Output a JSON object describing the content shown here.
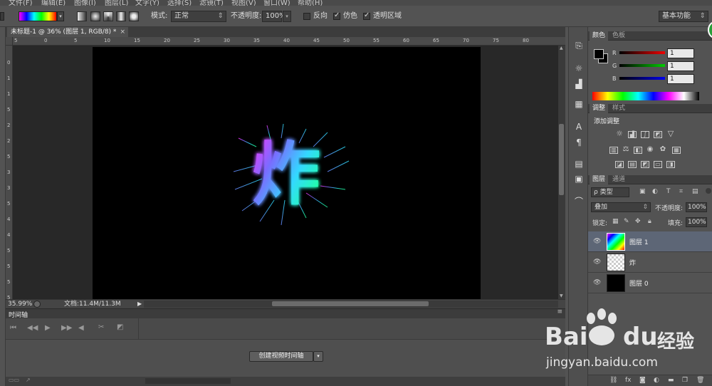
{
  "menubar": {
    "items": [
      "文件(F)",
      "编辑(E)",
      "图像(I)",
      "图层(L)",
      "文字(Y)",
      "选择(S)",
      "滤镜(T)",
      "视图(V)",
      "窗口(W)",
      "帮助(H)"
    ]
  },
  "options": {
    "mode_label": "模式:",
    "mode_value": "正常",
    "opacity_label": "不透明度:",
    "opacity_value": "100%",
    "reverse_label": "反向",
    "dither_label": "仿色",
    "transparency_label": "透明区域",
    "workspace": "基本功能",
    "reverse_checked": false,
    "dither_checked": true,
    "transparency_checked": true
  },
  "document": {
    "tab_title": "未标题-1 @ 36% (图层 1, RGB/8) *",
    "tab_close": "×",
    "canvas_text": "炸",
    "h_ruler_ticks": [
      "5",
      "0",
      "5",
      "10",
      "15",
      "20",
      "25",
      "30",
      "35",
      "40",
      "45",
      "50",
      "55",
      "60",
      "65",
      "70",
      "75",
      "80"
    ],
    "v_ruler_ticks": [
      "0",
      "1",
      "1",
      "5",
      "2",
      "2",
      "5",
      "3",
      "3",
      "5",
      "4",
      "4",
      "5",
      "5",
      "5",
      "5"
    ]
  },
  "status": {
    "zoom": "35.99%",
    "doc_info": "文档:11.4M/11.3M"
  },
  "timeline": {
    "title": "时间轴",
    "create_button": "创建视频时间轴"
  },
  "color_panel": {
    "tabs": [
      "颜色",
      "色板"
    ],
    "channels": [
      {
        "label": "R",
        "value": "1",
        "color": "#cc0000"
      },
      {
        "label": "G",
        "value": "1",
        "color": "#00aa00"
      },
      {
        "label": "B",
        "value": "1",
        "color": "#0000cc"
      }
    ]
  },
  "adjust_panel": {
    "tabs": [
      "调整",
      "样式"
    ],
    "heading": "添加调整"
  },
  "layers_panel": {
    "tabs": [
      "图层",
      "通道"
    ],
    "filter_label": "ρ 类型",
    "blend_mode": "叠加",
    "opacity_label": "不透明度:",
    "opacity_value": "100%",
    "lock_label": "锁定:",
    "fill_label": "填充:",
    "fill_value": "100%",
    "layers": [
      {
        "name": "图层 1",
        "thumb": "gradient",
        "selected": true
      },
      {
        "name": "炸",
        "thumb": "transparent",
        "selected": false
      },
      {
        "name": "图层 0",
        "thumb": "black",
        "selected": false
      }
    ]
  },
  "watermark": {
    "brand": "Bai",
    "brand2": "du",
    "cn": "经验",
    "url": "jingyan.baidu.com"
  }
}
